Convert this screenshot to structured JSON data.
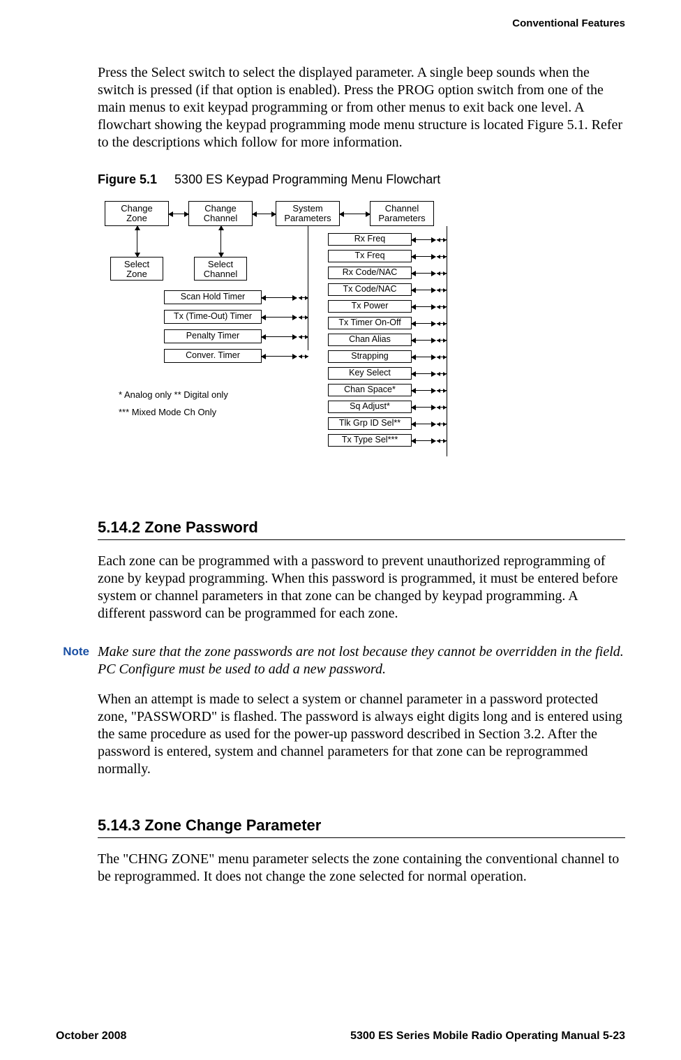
{
  "running_head": "Conventional Features",
  "intro_paragraph": "Press the Select switch to select the displayed parameter. A single beep sounds when the switch is pressed (if that option is enabled). Press the PROG option switch from one of the main menus to exit keypad programming or from other menus to exit back one level. A flowchart showing the keypad programming mode menu structure is located Figure 5.1. Refer to the descriptions which follow for more information.",
  "figure": {
    "number": "Figure 5.1",
    "title": "5300 ES Keypad Programming Menu Flowchart"
  },
  "flowchart": {
    "menus": {
      "change_zone": "Change\nZone",
      "change_channel": "Change\nChannel",
      "system_parameters": "System\nParameters",
      "channel_parameters": "Channel\nParameters"
    },
    "selects": {
      "select_zone": "Select\nZone",
      "select_channel": "Select\nChannel"
    },
    "system_items": [
      "Scan Hold Timer",
      "Tx (Time-Out) Timer",
      "Penalty Timer",
      "Conver. Timer"
    ],
    "channel_items": [
      "Rx Freq",
      "Tx Freq",
      "Rx Code/NAC",
      "Tx Code/NAC",
      "Tx Power",
      "Tx Timer On-Off",
      "Chan Alias",
      "Strapping",
      "Key Select",
      "Chan Space*",
      "Sq Adjust*",
      "Tlk Grp ID Sel**",
      "Tx Type Sel***"
    ],
    "legend_line1": "* Analog only      ** Digital only",
    "legend_line2": "*** Mixed Mode Ch Only"
  },
  "sections": {
    "s5142": {
      "head": "5.14.2   Zone Password",
      "p1": "Each zone can be programmed with a password to prevent unauthorized reprogramming of zone by keypad programming. When this password is programmed, it must be entered before system or channel parameters in that zone can be changed by keypad programming. A different password can be programmed for each zone.",
      "note_label": "Note",
      "note_text": "Make sure that the zone passwords are not lost because they cannot be overridden in the field. PC Configure must be used to add a new password.",
      "p2": "When an attempt is made to select a system or channel parameter in a password protected zone, \"PASSWORD\" is flashed. The password is always eight digits long and is entered using the same procedure as used for the power-up password described in Section 3.2. After the password is entered, system and channel parameters for that zone can be reprogrammed normally."
    },
    "s5143": {
      "head": "5.14.3   Zone Change Parameter",
      "p1": "The \"CHNG ZONE\" menu parameter selects the zone containing the conventional channel to be reprogrammed. It does not change the zone selected for normal operation."
    }
  },
  "footer": {
    "left": "October 2008",
    "right": "5300 ES Series Mobile Radio Operating Manual    5-23"
  }
}
